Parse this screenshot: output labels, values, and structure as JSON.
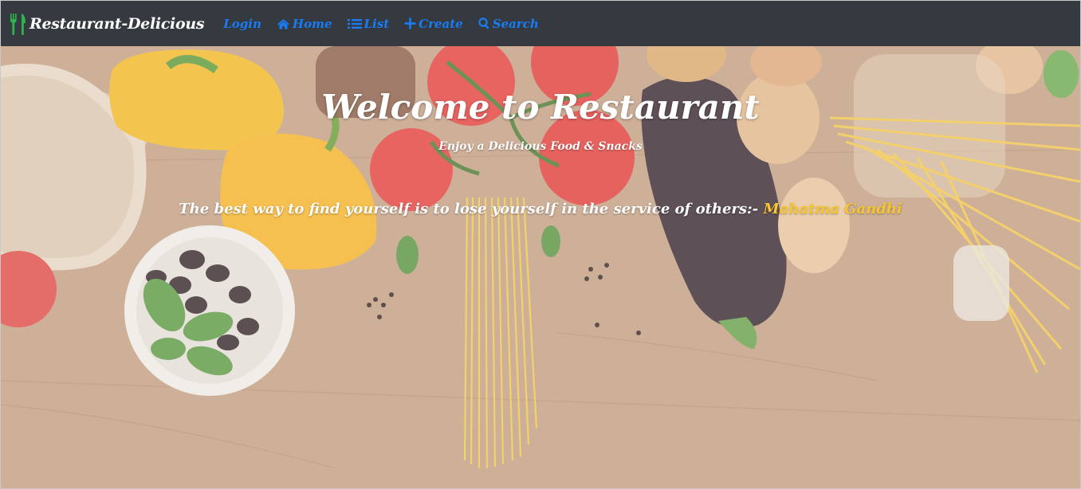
{
  "brand": {
    "name": "Restaurant-Delicious",
    "icon": "fork-knife-icon"
  },
  "nav": {
    "items": [
      {
        "label": "Login",
        "icon": ""
      },
      {
        "label": "Home",
        "icon": "home-icon"
      },
      {
        "label": "List",
        "icon": "list-icon"
      },
      {
        "label": "Create",
        "icon": "plus-icon"
      },
      {
        "label": "Search",
        "icon": "search-icon"
      }
    ]
  },
  "hero": {
    "title": "Welcome to Restaurant",
    "subtitle": "Enjoy a Delicious Food & Snacks",
    "quote": "The best way to find yourself is to lose yourself in the service of others:-",
    "author": "Mahatma Gandhi"
  },
  "colors": {
    "navbar_bg": "#343a40",
    "brand_icon": "#2fb34a",
    "nav_link": "#1a7cf5",
    "hero_text": "#ffffff",
    "author_text": "#f7c62f"
  }
}
